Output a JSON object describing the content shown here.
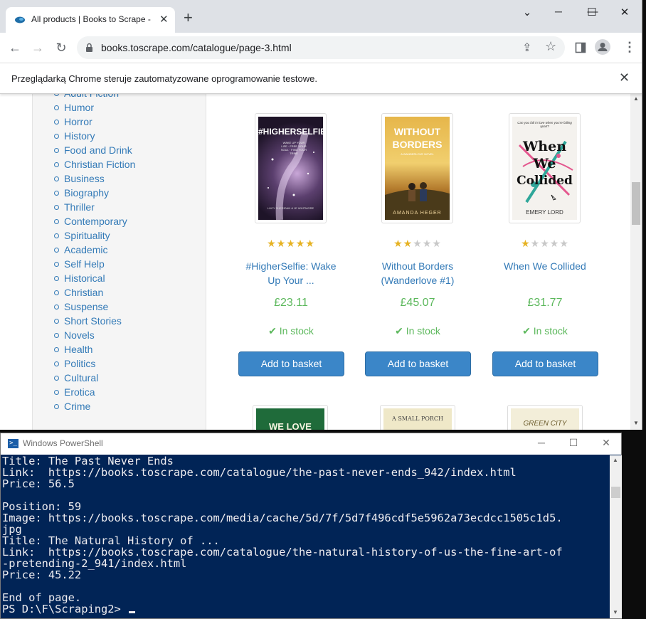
{
  "browser": {
    "tab_title": "All products | Books to Scrape -",
    "url": "books.toscrape.com/catalogue/page-3.html",
    "infobar_message": "Przeglądarką Chrome steruje zautomatyzowane oprogramowanie testowe."
  },
  "sidebar": {
    "categories": [
      "Adult Fiction",
      "Humor",
      "Horror",
      "History",
      "Food and Drink",
      "Christian Fiction",
      "Business",
      "Biography",
      "Thriller",
      "Contemporary",
      "Spirituality",
      "Academic",
      "Self Help",
      "Historical",
      "Christian",
      "Suspense",
      "Short Stories",
      "Novels",
      "Health",
      "Politics",
      "Cultural",
      "Erotica",
      "Crime"
    ]
  },
  "books": [
    {
      "title_line1": "#HigherSelfie: Wake",
      "title_line2": "Up Your ...",
      "price": "£23.11",
      "availability": "In stock",
      "button": "Add to basket",
      "rating": 5,
      "cover_text": "#HIGHERSELFIE",
      "cover_subtext": "WAKE UP YOUR LIFE · FREE YOUR SOUL · FIND YOUR TRIBE",
      "cover_author": "LUCY SHERIDAN & JE WHITMORE"
    },
    {
      "title_line1": "Without Borders",
      "title_line2": "(Wanderlove #1)",
      "price": "£45.07",
      "availability": "In stock",
      "button": "Add to basket",
      "rating": 2,
      "cover_text_1": "WITHOUT",
      "cover_text_2": "BORDERS",
      "cover_subtext": "A WANDERLOVE NOVEL",
      "cover_author": "AMANDA HEGER"
    },
    {
      "title_line1": "When We Collided",
      "title_line2": "",
      "price": "£31.77",
      "availability": "In stock",
      "button": "Add to basket",
      "rating": 1,
      "cover_tagline": "Can you fall in love when you're falling apart?",
      "cover_text_1": "When",
      "cover_text_2": "We",
      "cover_text_3": "Collided",
      "cover_author": "EMERY LORD"
    }
  ],
  "next_row_covers": {
    "cover1_text": "WE LOVE",
    "cover2_text": "A SMALL PORCH",
    "cover3_text": "GREEN CITY"
  },
  "powershell": {
    "title": "Windows PowerShell",
    "lines": [
      "Title: The Past Never Ends",
      "Link:  https://books.toscrape.com/catalogue/the-past-never-ends_942/index.html",
      "Price: 56.5",
      "",
      "Position: 59",
      "Image: https://books.toscrape.com/media/cache/5d/7f/5d7f496cdf5e5962a73ecdcc1505c1d5.",
      "jpg",
      "Title: The Natural History of ...",
      "Link:  https://books.toscrape.com/catalogue/the-natural-history-of-us-the-fine-art-of",
      "-pretending-2_941/index.html",
      "Price: 45.22",
      "",
      "End of page."
    ],
    "prompt": "PS D:\\F\\Scraping2> "
  },
  "colors": {
    "link": "#337ab7",
    "price_green": "#5cb85c",
    "star_gold": "#e6b222",
    "button_blue": "#3b86c8",
    "powershell_bg": "#012456"
  }
}
